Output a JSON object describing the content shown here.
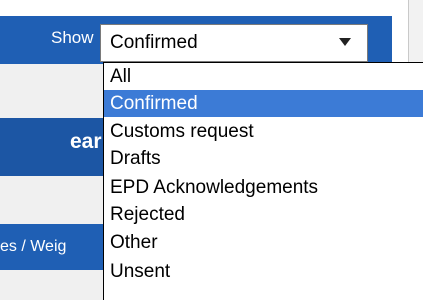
{
  "filter": {
    "label": "Show",
    "selected_value": "Confirmed",
    "options": [
      "All",
      "Confirmed",
      "Customs request",
      "Drafts",
      "EPD Acknowledgements",
      "Rejected",
      "Other",
      "Unsent"
    ],
    "highlighted_index": 1
  },
  "background": {
    "partial_heading": "ear",
    "partial_column": "es / Weig"
  },
  "colors": {
    "header_blue": "#1f5fb4",
    "selection_blue": "#3c7bd6"
  },
  "icons": {
    "dropdown_arrow": "triangle-down-icon"
  }
}
